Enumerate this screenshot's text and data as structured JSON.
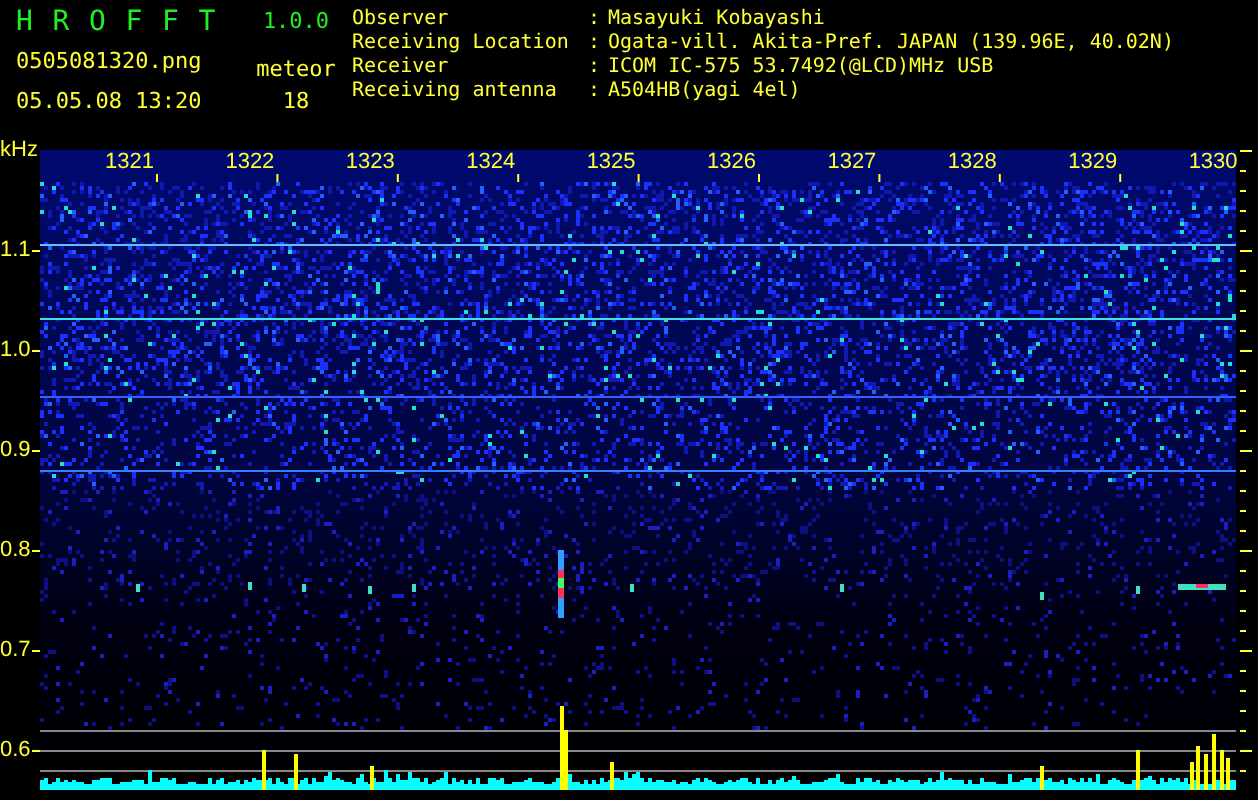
{
  "app": {
    "title": "H R O F F T",
    "version": "1.0.0"
  },
  "file": "0505081320.png",
  "datetime": "05.05.08 13:20",
  "meteor": {
    "label": "meteor",
    "count": "18"
  },
  "info": [
    {
      "label": "Observer",
      "separator": ":",
      "value": "Masayuki Kobayashi"
    },
    {
      "label": "Receiving Location",
      "separator": ":",
      "value": "Ogata-vill. Akita-Pref. JAPAN (139.96E, 40.02N)"
    },
    {
      "label": "Receiver",
      "separator": ":",
      "value": "ICOM IC-575 53.7492(@LCD)MHz USB"
    },
    {
      "label": "Receiving antenna",
      "separator": ":",
      "value": "A504HB(yagi 4el)"
    }
  ],
  "spectrogram": {
    "unit": "kHz",
    "time_labels": [
      "1321",
      "1322",
      "1323",
      "1324",
      "1325",
      "1326",
      "1327",
      "1328",
      "1329",
      "1330"
    ],
    "frequency_labels": [
      "1.1",
      "1.0",
      "0.9",
      "0.8",
      "0.7",
      "0.6"
    ]
  }
}
